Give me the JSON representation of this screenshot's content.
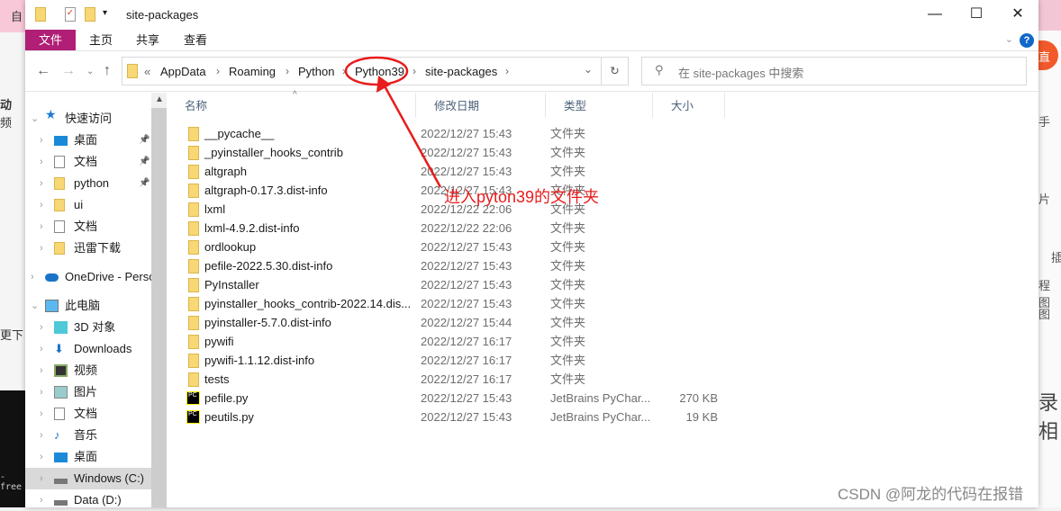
{
  "background": {
    "left_texts": [
      "自",
      "动",
      "频",
      "更下",
      "-free"
    ],
    "right_texts": [
      "直",
      "手",
      "片",
      "插",
      "程图",
      "图",
      "录相"
    ]
  },
  "window": {
    "title": "site-packages",
    "controls": {
      "minimize": "—",
      "maximize": "☐",
      "close": "✕"
    }
  },
  "ribbon": {
    "tabs": [
      "文件",
      "主页",
      "共享",
      "查看"
    ],
    "help": "?"
  },
  "address": {
    "overflow": "«",
    "segments": [
      "AppData",
      "Roaming",
      "Python",
      "Python39",
      "site-packages"
    ]
  },
  "search": {
    "placeholder": "在 site-packages 中搜索"
  },
  "nav": {
    "items": [
      {
        "label": "快速访问",
        "icon": "star-icon",
        "level": 0,
        "expanded": true
      },
      {
        "label": "桌面",
        "icon": "desktop-icon",
        "level": 1,
        "pinned": true
      },
      {
        "label": "文档",
        "icon": "document-icon",
        "level": 1,
        "pinned": true
      },
      {
        "label": "python",
        "icon": "folder-icon",
        "level": 1,
        "pinned": true
      },
      {
        "label": "ui",
        "icon": "folder-icon",
        "level": 1
      },
      {
        "label": "文档",
        "icon": "document-icon",
        "level": 1
      },
      {
        "label": "迅雷下载",
        "icon": "folder-icon",
        "level": 1
      },
      {
        "label": "OneDrive - Personal",
        "icon": "cloud-icon",
        "level": 0
      },
      {
        "label": "此电脑",
        "icon": "computer-icon",
        "level": 0,
        "expanded": true
      },
      {
        "label": "3D 对象",
        "icon": "cube-icon",
        "level": 1
      },
      {
        "label": "Downloads",
        "icon": "download-icon",
        "level": 1
      },
      {
        "label": "视频",
        "icon": "video-icon",
        "level": 1
      },
      {
        "label": "图片",
        "icon": "picture-icon",
        "level": 1
      },
      {
        "label": "文档",
        "icon": "document-icon",
        "level": 1
      },
      {
        "label": "音乐",
        "icon": "music-icon",
        "level": 1
      },
      {
        "label": "桌面",
        "icon": "desktop-icon",
        "level": 1
      },
      {
        "label": "Windows (C:)",
        "icon": "drive-icon",
        "level": 1,
        "selected": true
      },
      {
        "label": "Data (D:)",
        "icon": "drive-icon",
        "level": 1
      }
    ]
  },
  "columns": {
    "name": "名称",
    "date": "修改日期",
    "type": "类型",
    "size": "大小"
  },
  "files": [
    {
      "name": "__pycache__",
      "date": "2022/12/27 15:43",
      "type": "文件夹",
      "size": "",
      "kind": "folder"
    },
    {
      "name": "_pyinstaller_hooks_contrib",
      "date": "2022/12/27 15:43",
      "type": "文件夹",
      "size": "",
      "kind": "folder"
    },
    {
      "name": "altgraph",
      "date": "2022/12/27 15:43",
      "type": "文件夹",
      "size": "",
      "kind": "folder"
    },
    {
      "name": "altgraph-0.17.3.dist-info",
      "date": "2022/12/27 15:43",
      "type": "文件夹",
      "size": "",
      "kind": "folder"
    },
    {
      "name": "lxml",
      "date": "2022/12/22 22:06",
      "type": "文件夹",
      "size": "",
      "kind": "folder"
    },
    {
      "name": "lxml-4.9.2.dist-info",
      "date": "2022/12/22 22:06",
      "type": "文件夹",
      "size": "",
      "kind": "folder"
    },
    {
      "name": "ordlookup",
      "date": "2022/12/27 15:43",
      "type": "文件夹",
      "size": "",
      "kind": "folder"
    },
    {
      "name": "pefile-2022.5.30.dist-info",
      "date": "2022/12/27 15:43",
      "type": "文件夹",
      "size": "",
      "kind": "folder"
    },
    {
      "name": "PyInstaller",
      "date": "2022/12/27 15:43",
      "type": "文件夹",
      "size": "",
      "kind": "folder"
    },
    {
      "name": "pyinstaller_hooks_contrib-2022.14.dis...",
      "date": "2022/12/27 15:43",
      "type": "文件夹",
      "size": "",
      "kind": "folder"
    },
    {
      "name": "pyinstaller-5.7.0.dist-info",
      "date": "2022/12/27 15:44",
      "type": "文件夹",
      "size": "",
      "kind": "folder"
    },
    {
      "name": "pywifi",
      "date": "2022/12/27 16:17",
      "type": "文件夹",
      "size": "",
      "kind": "folder"
    },
    {
      "name": "pywifi-1.1.12.dist-info",
      "date": "2022/12/27 16:17",
      "type": "文件夹",
      "size": "",
      "kind": "folder"
    },
    {
      "name": "tests",
      "date": "2022/12/27 16:17",
      "type": "文件夹",
      "size": "",
      "kind": "folder"
    },
    {
      "name": "pefile.py",
      "date": "2022/12/27 15:43",
      "type": "JetBrains PyChar...",
      "size": "270 KB",
      "kind": "pycharm"
    },
    {
      "name": "peutils.py",
      "date": "2022/12/27 15:43",
      "type": "JetBrains PyChar...",
      "size": "19 KB",
      "kind": "pycharm"
    }
  ],
  "annotation": {
    "text": "进入pyton39的文件夹",
    "color": "#e81c1c"
  },
  "watermark": "CSDN @阿龙的代码在报错",
  "colors": {
    "file_tab": "#b01e75",
    "folder": "#f8d775",
    "selected": "#d9d9d9"
  }
}
